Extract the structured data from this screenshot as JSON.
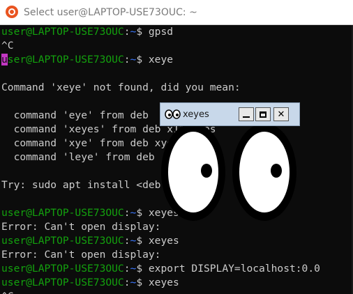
{
  "terminal": {
    "title": "Select user@LAPTOP-USE73OUC: ~",
    "lines": [
      [
        {
          "t": "user@LAPTOP-USE73OUC",
          "c": "u"
        },
        {
          "t": ":",
          "c": ""
        },
        {
          "t": "~",
          "c": "p"
        },
        {
          "t": "$ gpsd",
          "c": ""
        }
      ],
      [
        {
          "t": "^C",
          "c": ""
        }
      ],
      [
        {
          "t": "u",
          "c": "cursorU"
        },
        {
          "t": "ser@LAPTOP-USE73OUC",
          "c": "u"
        },
        {
          "t": ":",
          "c": ""
        },
        {
          "t": "~",
          "c": "p"
        },
        {
          "t": "$ xeye",
          "c": ""
        }
      ],
      [
        {
          "t": "",
          "c": ""
        }
      ],
      [
        {
          "t": "Command 'xeye' not found, did you mean:",
          "c": ""
        }
      ],
      [
        {
          "t": "",
          "c": ""
        }
      ],
      [
        {
          "t": "  command 'eye' from deb",
          "c": ""
        }
      ],
      [
        {
          "t": "  command 'xeyes' from deb x11-apps",
          "c": ""
        }
      ],
      [
        {
          "t": "  command 'xye' from deb xye",
          "c": ""
        }
      ],
      [
        {
          "t": "  command 'leye' from deb",
          "c": ""
        }
      ],
      [
        {
          "t": "",
          "c": ""
        }
      ],
      [
        {
          "t": "Try: sudo apt install <deb name>",
          "c": ""
        }
      ],
      [
        {
          "t": "",
          "c": ""
        }
      ],
      [
        {
          "t": "user@LAPTOP-USE73OUC",
          "c": "u"
        },
        {
          "t": ":",
          "c": ""
        },
        {
          "t": "~",
          "c": "p"
        },
        {
          "t": "$ xeyes",
          "c": ""
        }
      ],
      [
        {
          "t": "Error: Can't open display:",
          "c": ""
        }
      ],
      [
        {
          "t": "user@LAPTOP-USE73OUC",
          "c": "u"
        },
        {
          "t": ":",
          "c": ""
        },
        {
          "t": "~",
          "c": "p"
        },
        {
          "t": "$ xeyes",
          "c": ""
        }
      ],
      [
        {
          "t": "Error: Can't open display:",
          "c": ""
        }
      ],
      [
        {
          "t": "user@LAPTOP-USE73OUC",
          "c": "u"
        },
        {
          "t": ":",
          "c": ""
        },
        {
          "t": "~",
          "c": "p"
        },
        {
          "t": "$ export DISPLAY=localhost:0.0",
          "c": ""
        }
      ],
      [
        {
          "t": "user@LAPTOP-USE73OUC",
          "c": "u"
        },
        {
          "t": ":",
          "c": ""
        },
        {
          "t": "~",
          "c": "p"
        },
        {
          "t": "$ xeyes",
          "c": ""
        }
      ],
      [
        {
          "t": "^C",
          "c": ""
        }
      ]
    ]
  },
  "xeyes": {
    "title": "xeyes",
    "close_label": "✕"
  },
  "colors": {
    "terminal_bg": "#0c0c0c",
    "prompt_user": "#13a10e",
    "prompt_path": "#3b78ff",
    "text": "#cccccc",
    "cursor": "#c237c2",
    "ubuntu": "#e95420"
  },
  "icons": [
    "ubuntu-logo-icon",
    "xeyes-app-icon",
    "minimize-icon",
    "maximize-icon",
    "close-icon"
  ]
}
